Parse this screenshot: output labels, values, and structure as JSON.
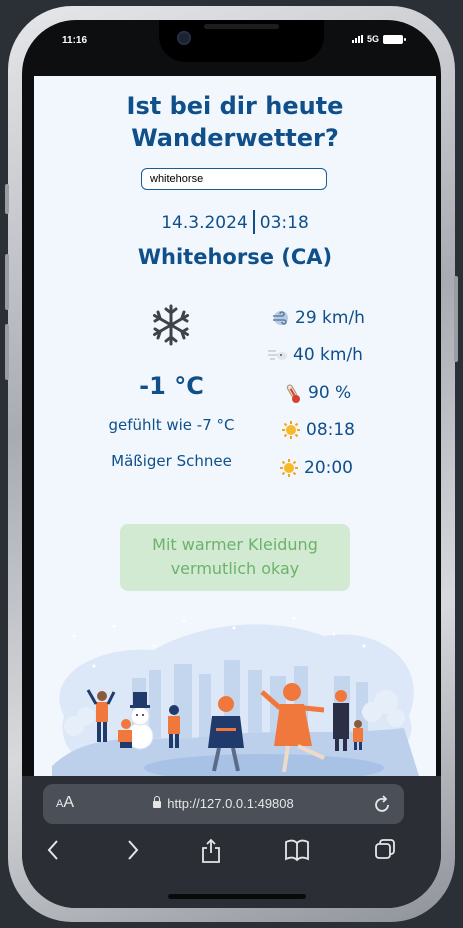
{
  "status": {
    "time": "11:16",
    "network": "5G"
  },
  "app": {
    "title_line1": "Ist bei dir heute",
    "title_line2": "Wanderwetter?",
    "search_value": "whitehorse"
  },
  "weather": {
    "date": "14.3.2024",
    "time": "03:18",
    "city": "Whitehorse (CA)",
    "temperature": "-1 °C",
    "feels_like": "gefühlt wie -7 °C",
    "description": "Mäßiger Schnee",
    "condition_icon": "snowflake-icon",
    "wind_speed": "29 km/h",
    "wind_gust": "40 km/h",
    "humidity": "90 %",
    "sunrise": "08:18",
    "sunset": "20:00"
  },
  "advice": {
    "line1": "Mit warmer Kleidung",
    "line2": "vermutlich okay",
    "bg_color": "#d2ead2",
    "text_color": "#6bb36b"
  },
  "browser": {
    "aa_label": "A",
    "aa_small": "A",
    "url": "http://127.0.0.1:49808"
  },
  "colors": {
    "primary": "#0f4f8a",
    "background": "#f1f7fd"
  }
}
